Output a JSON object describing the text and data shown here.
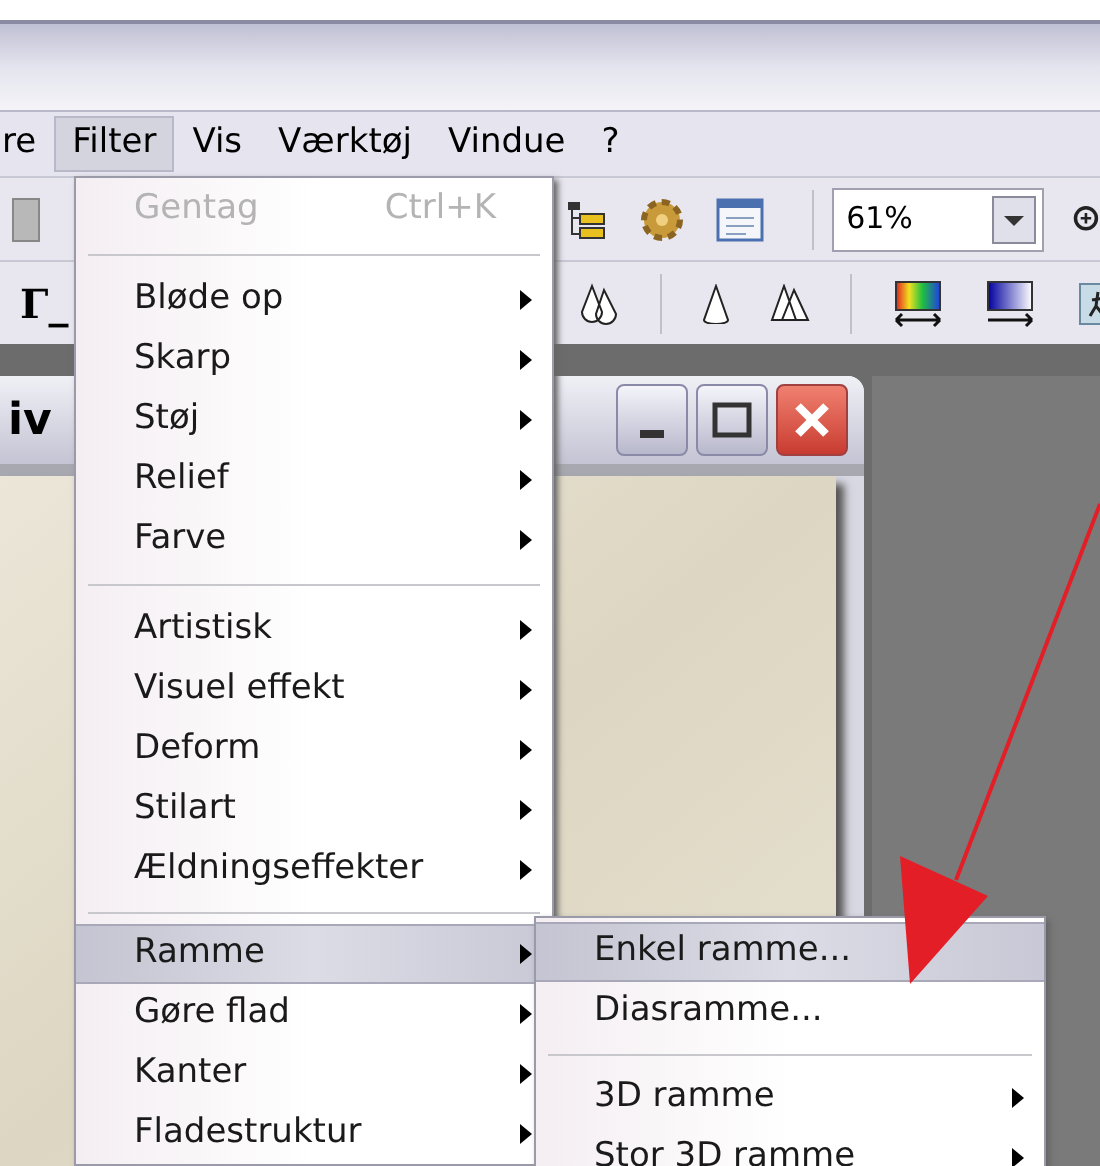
{
  "menu_bar": [
    {
      "label": "re",
      "selected": false
    },
    {
      "label": "Filter",
      "selected": true
    },
    {
      "label": "Vis",
      "selected": false
    },
    {
      "label": "Værktøj",
      "selected": false
    },
    {
      "label": "Vindue",
      "selected": false
    },
    {
      "label": "?",
      "selected": false
    }
  ],
  "toolbar": {
    "tool_label": "Γ_",
    "zoom_field": {
      "value": "61%"
    }
  },
  "document_window": {
    "title": "iv"
  },
  "filter_menu": {
    "items": [
      {
        "kind": "item",
        "label": "Gentag",
        "shortcut": "Ctrl+K",
        "disabled": true,
        "submenu": false,
        "selected": false
      },
      {
        "kind": "separator"
      },
      {
        "kind": "item",
        "label": "Bløde op",
        "disabled": false,
        "submenu": true,
        "selected": false
      },
      {
        "kind": "item",
        "label": "Skarp",
        "disabled": false,
        "submenu": true,
        "selected": false
      },
      {
        "kind": "item",
        "label": "Støj",
        "disabled": false,
        "submenu": true,
        "selected": false
      },
      {
        "kind": "item",
        "label": "Relief",
        "disabled": false,
        "submenu": true,
        "selected": false
      },
      {
        "kind": "item",
        "label": "Farve",
        "disabled": false,
        "submenu": true,
        "selected": false
      },
      {
        "kind": "separator"
      },
      {
        "kind": "item",
        "label": "Artistisk",
        "disabled": false,
        "submenu": true,
        "selected": false
      },
      {
        "kind": "item",
        "label": "Visuel effekt",
        "disabled": false,
        "submenu": true,
        "selected": false
      },
      {
        "kind": "item",
        "label": "Deform",
        "disabled": false,
        "submenu": true,
        "selected": false
      },
      {
        "kind": "item",
        "label": "Stilart",
        "disabled": false,
        "submenu": true,
        "selected": false
      },
      {
        "kind": "item",
        "label": "Ældningseffekter",
        "disabled": false,
        "submenu": true,
        "selected": false
      },
      {
        "kind": "separator"
      },
      {
        "kind": "item",
        "label": "Ramme",
        "disabled": false,
        "submenu": true,
        "selected": true
      },
      {
        "kind": "item",
        "label": "Gøre flad",
        "disabled": false,
        "submenu": true,
        "selected": false
      },
      {
        "kind": "item",
        "label": "Kanter",
        "disabled": false,
        "submenu": true,
        "selected": false
      },
      {
        "kind": "item",
        "label": "Fladestruktur",
        "disabled": false,
        "submenu": true,
        "selected": false
      }
    ]
  },
  "ramme_submenu": {
    "items": [
      {
        "kind": "item",
        "label": "Enkel ramme...",
        "disabled": false,
        "submenu": false,
        "selected": true
      },
      {
        "kind": "item",
        "label": "Diasramme...",
        "disabled": false,
        "submenu": false,
        "selected": false
      },
      {
        "kind": "separator"
      },
      {
        "kind": "item",
        "label": "3D ramme",
        "disabled": false,
        "submenu": true,
        "selected": false
      },
      {
        "kind": "item",
        "label": "Stor 3D ramme",
        "disabled": false,
        "submenu": true,
        "selected": false
      }
    ]
  }
}
